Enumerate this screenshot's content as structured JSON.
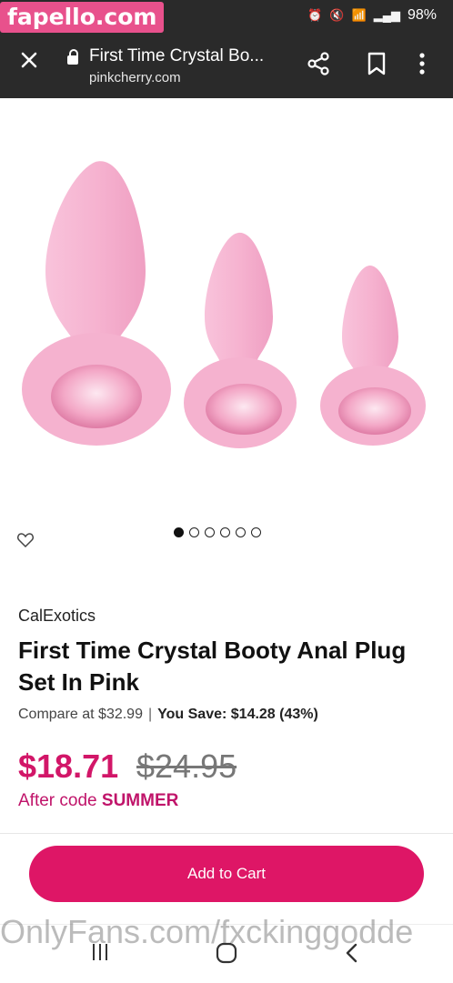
{
  "watermark": {
    "top": "fapello.com",
    "bottom": "OnlyFans.com/fxckinggodde"
  },
  "status_bar": {
    "battery": "98%"
  },
  "browser": {
    "page_title": "First Time Crystal Bo...",
    "domain": "pinkcherry.com"
  },
  "carousel": {
    "count": 6,
    "active_index": 0
  },
  "product": {
    "brand": "CalExotics",
    "name": "First Time Crystal Booty Anal Plug Set In Pink",
    "compare_text": "Compare at $32.99",
    "save_label": "You Save:",
    "save_value": "$14.28 (43%)",
    "price": "$18.71",
    "old_price": "$24.95",
    "after_code_prefix": "After code",
    "after_code": "SUMMER",
    "add_to_cart": "Add to Cart"
  },
  "colors": {
    "accent": "#de1666",
    "price": "#d21668",
    "topbar": "#2a2a2a",
    "watermark_bg": "#e8518c",
    "plug_pink": "#f6b6d2"
  }
}
